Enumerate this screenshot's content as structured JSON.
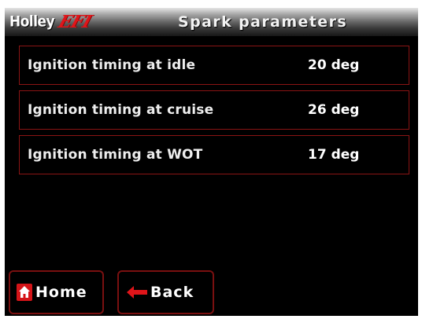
{
  "header": {
    "brand": "Holley",
    "brand_suffix": "EFI",
    "title": "Spark parameters"
  },
  "parameters": [
    {
      "label": "Ignition timing at idle",
      "value": "20 deg"
    },
    {
      "label": "Ignition timing at cruise",
      "value": "26 deg"
    },
    {
      "label": "Ignition timing at WOT",
      "value": "17 deg"
    }
  ],
  "buttons": {
    "home": {
      "label": "Home",
      "icon": "home-icon"
    },
    "back": {
      "label": "Back",
      "icon": "arrow-left-icon"
    }
  },
  "colors": {
    "background": "#000000",
    "accent_red": "#e0151a",
    "border_red": "#8a1414",
    "text": "#ffffff"
  }
}
